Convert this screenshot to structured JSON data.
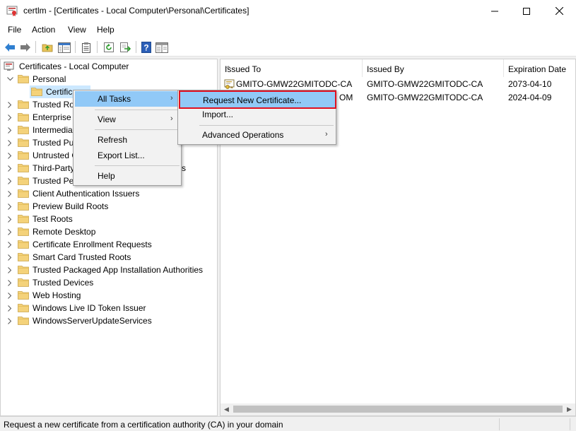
{
  "window": {
    "title": "certlm - [Certificates - Local Computer\\Personal\\Certificates]",
    "controls": [
      "minimize",
      "maximize",
      "close"
    ]
  },
  "menubar": [
    "File",
    "Action",
    "View",
    "Help"
  ],
  "toolbar": {
    "icons": [
      "back-icon",
      "forward-icon",
      "up-folder-icon",
      "show-hide-tree-icon",
      "properties-icon",
      "refresh-icon",
      "export-list-icon",
      "help-icon",
      "console-icon"
    ]
  },
  "tree": {
    "root": "Certificates - Local Computer",
    "items": [
      {
        "label": "Personal",
        "expanded": true
      },
      {
        "label": "Certificates",
        "visible": "Certific",
        "selected": true
      },
      {
        "label": "Trusted Root Certification Authorities",
        "visible": "Trusted Ro"
      },
      {
        "label": "Enterprise Trust",
        "visible": "Enterprise T"
      },
      {
        "label": "Intermediate Certification Authorities",
        "visible": "Intermedia"
      },
      {
        "label": "Trusted Publishers",
        "visible": "Trusted Pul"
      },
      {
        "label": "Untrusted Certificates",
        "visible": "Untrusted C"
      },
      {
        "label": "Third-Party Root Certification Authorities",
        "visible": "Third-Party",
        "tail": "s"
      },
      {
        "label": "Trusted People",
        "visible": "Trusted Peo"
      },
      {
        "label": "Client Authentication Issuers"
      },
      {
        "label": "Preview Build Roots"
      },
      {
        "label": "Test Roots"
      },
      {
        "label": "Remote Desktop"
      },
      {
        "label": "Certificate Enrollment Requests"
      },
      {
        "label": "Smart Card Trusted Roots"
      },
      {
        "label": "Trusted Packaged App Installation Authorities"
      },
      {
        "label": "Trusted Devices"
      },
      {
        "label": "Web Hosting"
      },
      {
        "label": "Windows Live ID Token Issuer"
      },
      {
        "label": "WindowsServerUpdateServices"
      }
    ]
  },
  "list": {
    "columns": [
      "Issued To",
      "Issued By",
      "Expiration Date"
    ],
    "rows": [
      {
        "issued_to": "GMITO-GMW22GMITODC-CA",
        "issued_by": "GMITO-GMW22GMITODC-CA",
        "expiration": "2073-04-10"
      },
      {
        "issued_to_visible_tail": "OM",
        "issued_by": "GMITO-GMW22GMITODC-CA",
        "expiration": "2024-04-09"
      }
    ]
  },
  "context_menu": {
    "items": [
      "All Tasks",
      "View",
      "Refresh",
      "Export List...",
      "Help"
    ],
    "highlighted": "All Tasks"
  },
  "submenu": {
    "items": [
      "Request New Certificate...",
      "Import...",
      "Advanced Operations"
    ],
    "highlighted": "Request New Certificate..."
  },
  "statusbar": {
    "text": "Request a new certificate from a certification authority (CA) in your domain"
  },
  "colors": {
    "selection": "#cce8ff",
    "menu_highlight": "#91c9f7",
    "highlight_border": "#e01020",
    "folder": "#f4d27a"
  }
}
